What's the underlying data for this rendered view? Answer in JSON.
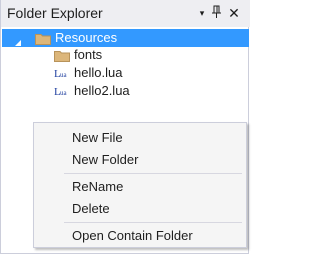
{
  "panel": {
    "title": "Folder Explorer",
    "icons": {
      "dropdown": "dropdown-arrow-icon",
      "pin": "pin-icon",
      "close": "close-icon"
    },
    "glyphs": {
      "dropdown": "▾",
      "pin": "ᐦ",
      "close": "✕"
    }
  },
  "tree": {
    "root": {
      "label": "Resources",
      "icon": "folder-icon",
      "expanded": true,
      "selected": true
    },
    "children": [
      {
        "label": "fonts",
        "icon": "folder-icon"
      },
      {
        "label": "hello.lua",
        "icon": "lua-file-icon"
      },
      {
        "label": "hello2.lua",
        "icon": "lua-file-icon"
      }
    ]
  },
  "context_menu": {
    "items": [
      {
        "label": "New File"
      },
      {
        "label": "New Folder"
      },
      {
        "label": "ReName"
      },
      {
        "label": "Delete"
      },
      {
        "label": "Open Contain Folder"
      }
    ]
  },
  "colors": {
    "selection": "#3399ff",
    "folder": "#dcb67a",
    "titlebar": "#eeeef2",
    "menu_bg": "#f5f5f5"
  }
}
